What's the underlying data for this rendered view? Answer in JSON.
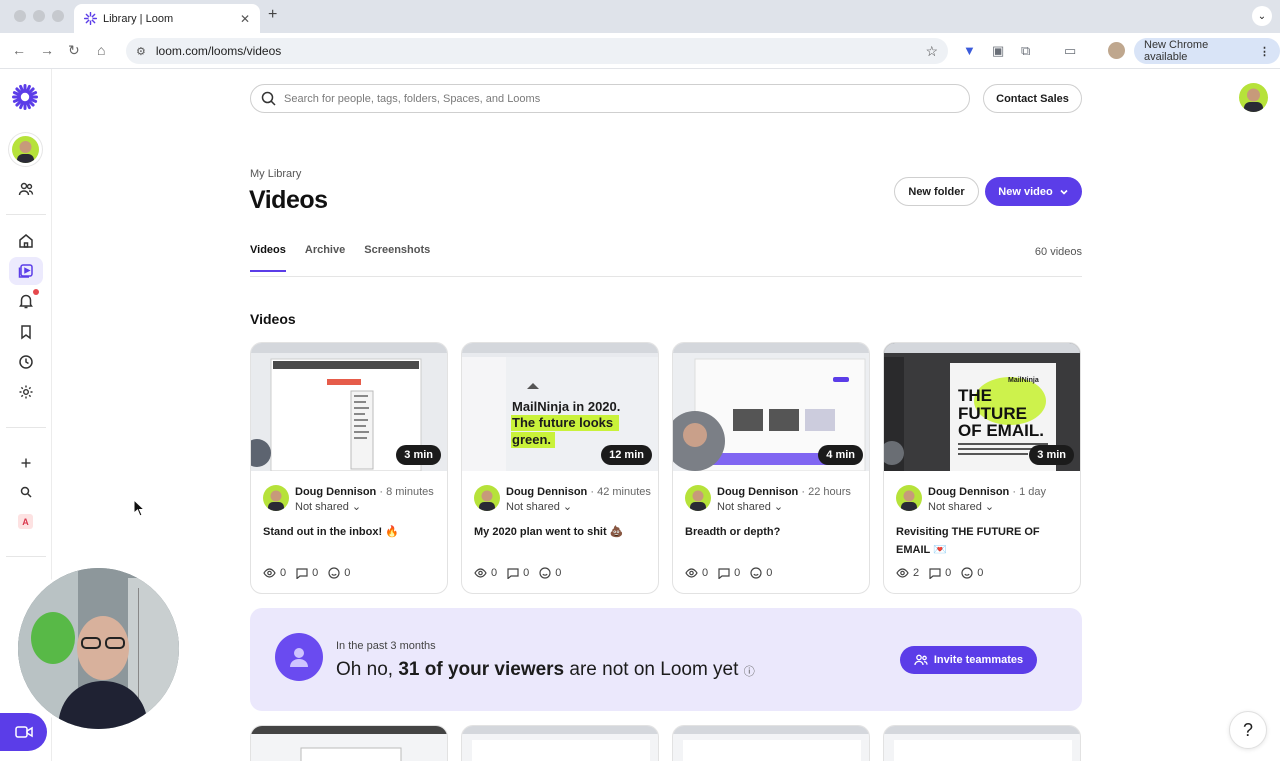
{
  "browser": {
    "tab_title": "Library | Loom",
    "url": "loom.com/looms/videos",
    "new_chrome_label": "New Chrome available"
  },
  "search": {
    "placeholder": "Search for people, tags, folders, Spaces, and Looms"
  },
  "header": {
    "contact_sales": "Contact Sales",
    "breadcrumb": "My Library",
    "title": "Videos",
    "new_folder": "New folder",
    "new_video": "New video"
  },
  "tabs": [
    {
      "label": "Videos",
      "active": true
    },
    {
      "label": "Archive",
      "active": false
    },
    {
      "label": "Screenshots",
      "active": false
    }
  ],
  "video_count": "60 videos",
  "section_title": "Videos",
  "videos": [
    {
      "duration": "3 min",
      "author": "Doug Dennison",
      "time": "8 minutes",
      "sharing": "Not shared",
      "title": "Stand out in the inbox! 🔥",
      "views": "0",
      "comments": "0",
      "reactions": "0"
    },
    {
      "duration": "12 min",
      "author": "Doug Dennison",
      "time": "42 minutes",
      "sharing": "Not shared",
      "title": "My 2020 plan went to shit 💩",
      "views": "0",
      "comments": "0",
      "reactions": "0",
      "thumb_text": [
        "MailNinja in 2020.",
        "The future looks",
        "green."
      ]
    },
    {
      "duration": "4 min",
      "author": "Doug Dennison",
      "time": "22 hours",
      "sharing": "Not shared",
      "title": "Breadth or depth?",
      "views": "0",
      "comments": "0",
      "reactions": "0"
    },
    {
      "duration": "3 min",
      "author": "Doug Dennison",
      "time": "1 day",
      "sharing": "Not shared",
      "title": "Revisiting THE FUTURE OF EMAIL 💌",
      "views": "2",
      "comments": "0",
      "reactions": "0",
      "thumb_text": [
        "THE",
        "FUTURE",
        "OF EMAIL.",
        "MailNinja"
      ]
    }
  ],
  "banner": {
    "subtitle": "In the past 3 months",
    "prefix": "Oh no, ",
    "highlight": "31 of your viewers",
    "suffix": " are not on Loom yet",
    "invite": "Invite teammates"
  },
  "rail": {
    "badge_letter": "A"
  },
  "help": "?",
  "colors": {
    "accent": "#5b3de8",
    "banner_bg": "#ebe8fc"
  }
}
